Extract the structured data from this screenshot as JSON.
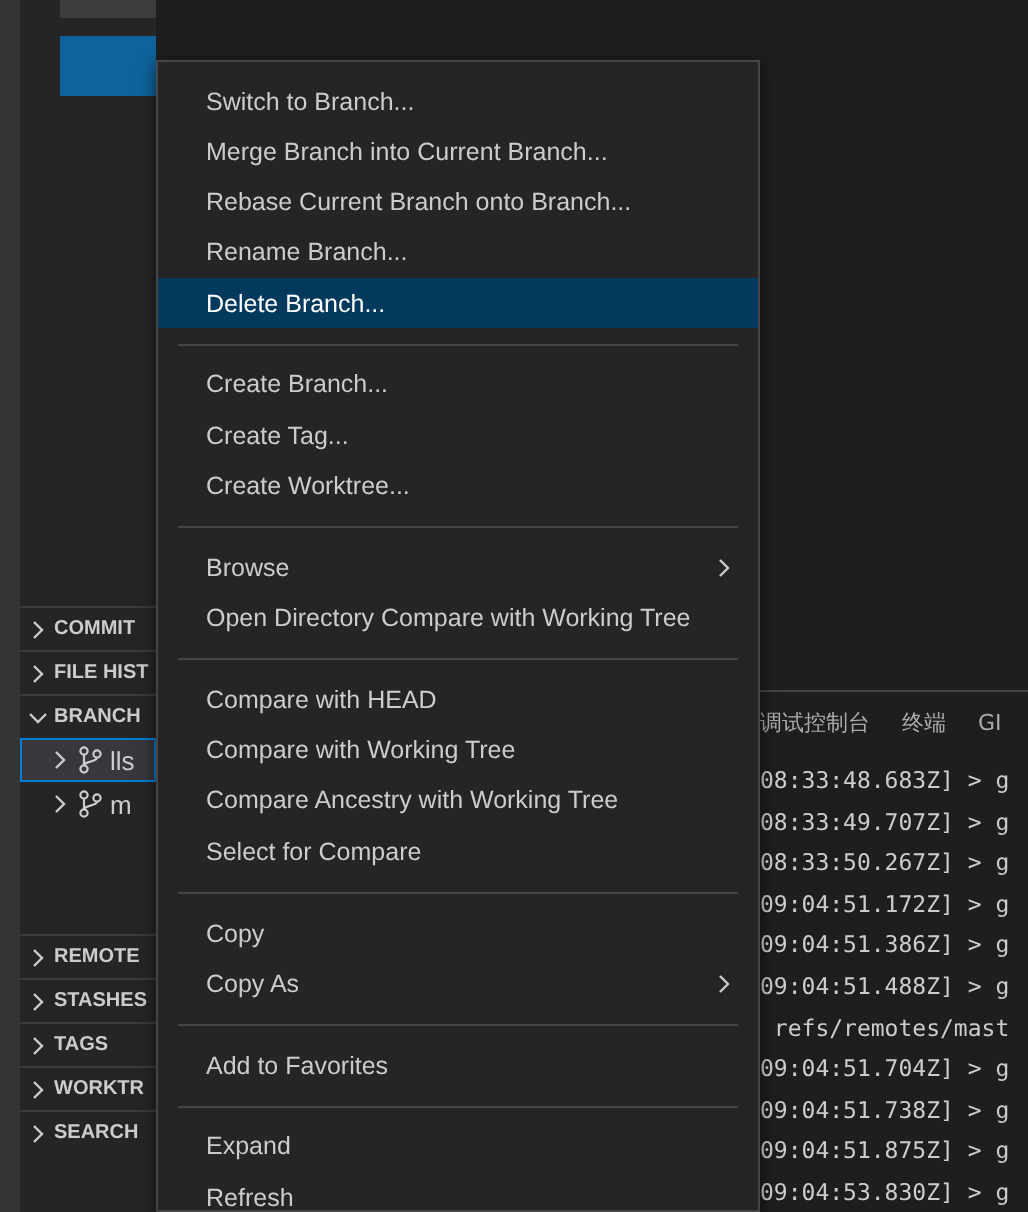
{
  "sidebar": {
    "sections": [
      {
        "label": "COMMIT",
        "expanded": false
      },
      {
        "label": "FILE HIST",
        "expanded": false
      },
      {
        "label": "BRANCH",
        "expanded": true,
        "children": [
          {
            "label": "lls",
            "selected": true
          },
          {
            "label": "m",
            "selected": false
          }
        ]
      },
      {
        "label": "REMOTE",
        "expanded": false
      },
      {
        "label": "STASHES",
        "expanded": false
      },
      {
        "label": "TAGS",
        "expanded": false
      },
      {
        "label": "WORKTR",
        "expanded": false
      },
      {
        "label": "SEARCH",
        "expanded": false
      }
    ]
  },
  "context_menu": {
    "groups": [
      {
        "items": [
          {
            "label": "Switch to Branch...",
            "selected": false,
            "submenu": false
          },
          {
            "label": "Merge Branch into Current Branch...",
            "selected": false,
            "submenu": false
          },
          {
            "label": "Rebase Current Branch onto Branch...",
            "selected": false,
            "submenu": false
          },
          {
            "label": "Rename Branch...",
            "selected": false,
            "submenu": false
          },
          {
            "label": "Delete Branch...",
            "selected": true,
            "submenu": false
          }
        ]
      },
      {
        "items": [
          {
            "label": "Create Branch...",
            "selected": false,
            "submenu": false
          },
          {
            "label": "Create Tag...",
            "selected": false,
            "submenu": false
          },
          {
            "label": "Create Worktree...",
            "selected": false,
            "submenu": false
          }
        ]
      },
      {
        "items": [
          {
            "label": "Browse",
            "selected": false,
            "submenu": true
          },
          {
            "label": "Open Directory Compare with Working Tree",
            "selected": false,
            "submenu": false
          }
        ]
      },
      {
        "items": [
          {
            "label": "Compare with HEAD",
            "selected": false,
            "submenu": false
          },
          {
            "label": "Compare with Working Tree",
            "selected": false,
            "submenu": false
          },
          {
            "label": "Compare Ancestry with Working Tree",
            "selected": false,
            "submenu": false
          },
          {
            "label": "Select for Compare",
            "selected": false,
            "submenu": false
          }
        ]
      },
      {
        "items": [
          {
            "label": "Copy",
            "selected": false,
            "submenu": false
          },
          {
            "label": "Copy As",
            "selected": false,
            "submenu": true
          }
        ]
      },
      {
        "items": [
          {
            "label": "Add to Favorites",
            "selected": false,
            "submenu": false
          }
        ]
      },
      {
        "items": [
          {
            "label": "Expand",
            "selected": false,
            "submenu": false
          },
          {
            "label": "Refresh",
            "selected": false,
            "submenu": false
          }
        ]
      }
    ]
  },
  "panel": {
    "tabs": [
      "调试控制台",
      "终端",
      "GI"
    ],
    "lines": [
      "08:33:48.683Z] > g",
      "08:33:49.707Z] > g",
      "08:33:50.267Z] > g",
      "09:04:51.172Z] > g",
      "09:04:51.386Z] > g",
      "09:04:51.488Z] > g",
      " refs/remotes/mast",
      "09:04:51.704Z] > g",
      "09:04:51.738Z] > g",
      "09:04:51.875Z] > g",
      "09:04:53.830Z] > g"
    ]
  }
}
